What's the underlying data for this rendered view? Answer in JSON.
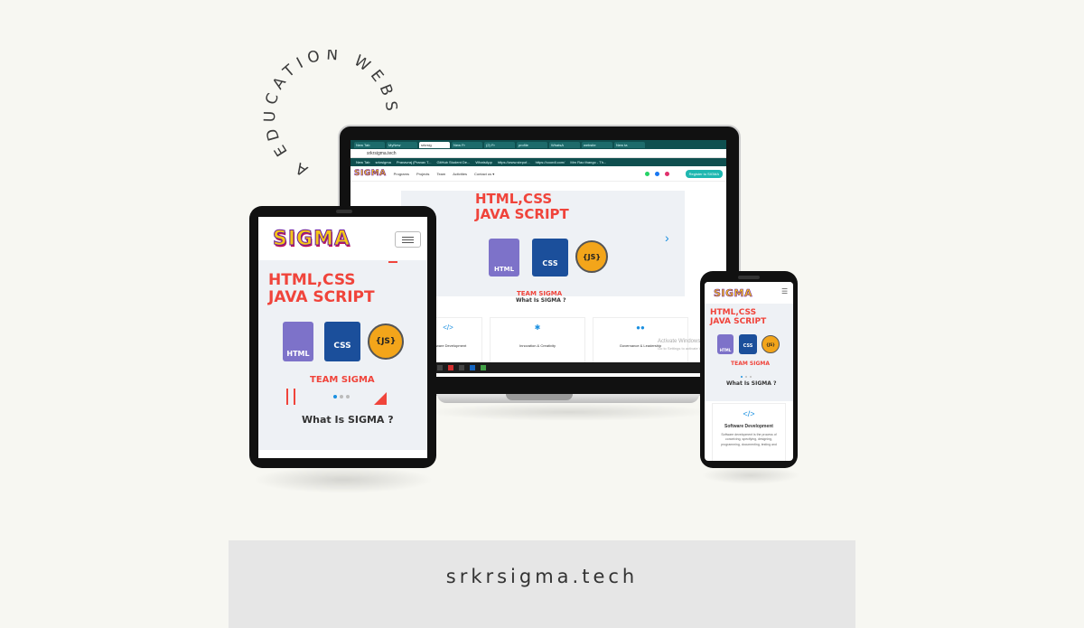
{
  "arc_text": "A EDUCATION WEBSITE",
  "footer": {
    "url": "srkrsigma.tech"
  },
  "laptop": {
    "tabs": [
      "New Tab",
      "MyNew",
      "srkrsig",
      "New Fr",
      "(2) Fr",
      "profile",
      "WhatsA",
      "website",
      "New ta"
    ],
    "address": "srkrsigma.tech",
    "bookmarks": [
      "New Tab",
      "srkrsigma",
      "Pranavraj (Pranav T...",
      "GitHub Student De...",
      "WhatsApp",
      "https://www.stepof...",
      "https://coordl.com/",
      "Mm Rao thango - Th..."
    ],
    "logo": "SIGMA",
    "nav_items": [
      "Programs",
      "Projects",
      "Team",
      "Activities",
      "Contact us ▾"
    ],
    "register_label": "Register to SIGMA",
    "hero_line1": "HTML,CSS",
    "hero_line2": "JAVA SCRIPT",
    "team_label": "TEAM SIGMA",
    "what_is": "What Is SIGMA ?",
    "features": [
      "Software Development",
      "Innovation & Creativity",
      "Governance & Leadership"
    ],
    "activate_windows": "Activate Windows",
    "activate_hint": "Go to Settings to activate Windows."
  },
  "tablet": {
    "logo": "SIGMA",
    "hero_line1": "HTML,CSS",
    "hero_line2": "JAVA SCRIPT",
    "team_label": "TEAM SIGMA",
    "what_is": "What Is SIGMA ?",
    "html_label": "HTML",
    "css_label": "CSS",
    "js_label": "{JS}"
  },
  "phone": {
    "logo": "SIGMA",
    "hero_line1": "HTML,CSS",
    "hero_line2": "JAVA SCRIPT",
    "team_label": "TEAM SIGMA",
    "what_is": "What Is SIGMA ?",
    "feature_title": "Software Development",
    "feature_text": "Software development is the process of conceiving, specifying, designing, programming, documenting, testing and"
  },
  "colors": {
    "accent_red": "#f0443b",
    "teal": "#1eb7b0",
    "brand_yellow": "#f5c518",
    "brand_purple": "#6a1b9a",
    "link_blue": "#1a8fe0"
  }
}
